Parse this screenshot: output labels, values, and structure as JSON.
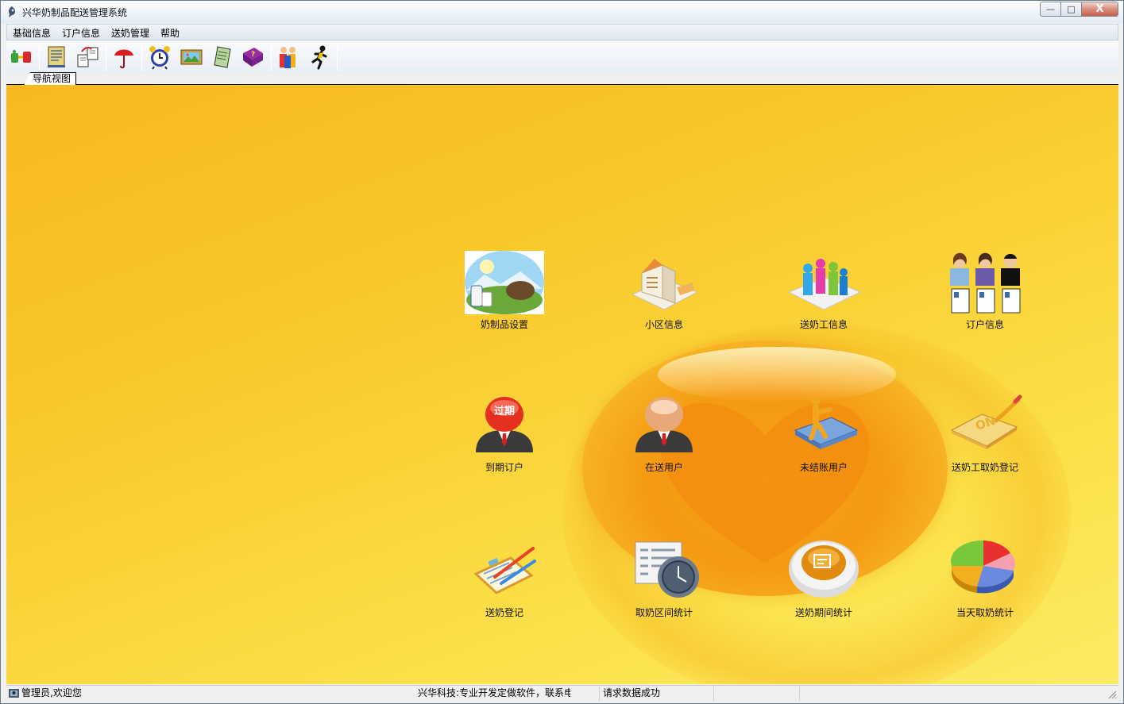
{
  "window": {
    "title": "兴华奶制品配送管理系统",
    "minimize_glyph": "—",
    "maximize_glyph": "□",
    "close_glyph": "X"
  },
  "menu": [
    "基础信息",
    "订户信息",
    "送奶管理",
    "帮助"
  ],
  "toolbar": {
    "buttons": [
      "connect-icon",
      "ledger-icon",
      "transfer-icon",
      "umbrella-icon",
      "alarm-clock-icon",
      "picture-icon",
      "notepad-icon",
      "help-book-icon",
      "team-icon",
      "runner-exit-icon"
    ]
  },
  "tabs": [
    "导航视图"
  ],
  "navigation": {
    "row1": [
      "奶制品设置",
      "小区信息",
      "送奶工信息",
      "订户信息"
    ],
    "row2": [
      "到期订户",
      "在送用户",
      "未结账用户",
      "送奶工取奶登记"
    ],
    "row3": [
      "送奶登记",
      "取奶区间统计",
      "送奶期间统计",
      "当天取奶统计"
    ],
    "expired_badge": "过期",
    "on_badge": "ON"
  },
  "statusbar": {
    "user": "管理员,欢迎您",
    "marquee": "兴华科技:专业开发定做软件，联系电",
    "status": "请求数据成功"
  },
  "colors": {
    "background_top": "#f7b91e",
    "background_bottom": "#fdeb62",
    "orb": "#f59a12"
  }
}
